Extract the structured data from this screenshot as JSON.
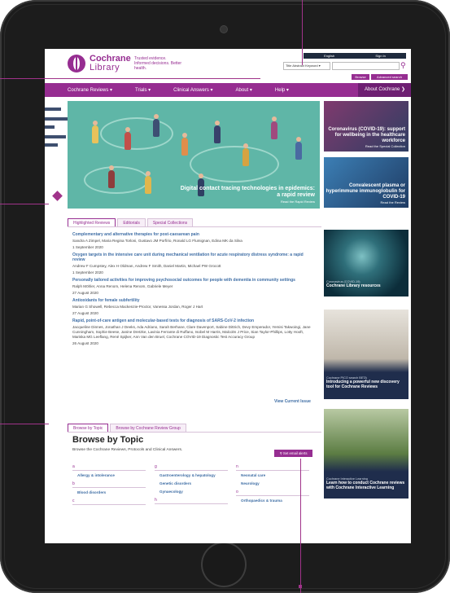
{
  "header": {
    "logo_line1": "Cochrane",
    "logo_line2": "Library",
    "tagline": "Trusted evidence. Informed decisions. Better health.",
    "top_links": [
      "English",
      "Sign In"
    ],
    "search_type": "Title Abstract Keyword ▾",
    "search_placeholder": "",
    "browse": "Browse",
    "advanced_search": "Advanced search"
  },
  "nav": {
    "items": [
      "Cochrane Reviews ▾",
      "Trials ▾",
      "Clinical Answers ▾",
      "About ▾",
      "Help ▾"
    ],
    "about_cochrane": "About Cochrane ❯"
  },
  "hero": {
    "title": "Digital contact tracing technologies in epidemics: a rapid review",
    "link": "Read the Rapid Review"
  },
  "side_cards": [
    {
      "title": "Coronavirus (COVID-19): support for wellbeing in the healthcare workforce",
      "link": "Read the Special Collection"
    },
    {
      "title": "Convalescent plasma or hyperimmune immunoglobulin for COVID-19",
      "link": "Read the Review"
    }
  ],
  "highlight_tabs": [
    "Highlighted Reviews",
    "Editorials",
    "Special Collections"
  ],
  "reviews": [
    {
      "title": "Complementary and alternative therapies for post-caesarean pain",
      "authors": "Sandra A Zimpel, Maria Regina Torloni, Gustavo JM Porfírio, Ronald LG Flumignan, Edina MK da Silva",
      "date": "1 September 2020"
    },
    {
      "title": "Oxygen targets in the intensive care unit during mechanical ventilation for acute respiratory distress syndrome: a rapid review",
      "authors": "Andrew F Cumpstey, Alex H Oldman, Andrew F Smith, Daniel Martin, Michael PW Grocott",
      "date": "1 September 2020"
    },
    {
      "title": "Personally tailored activities for improving psychosocial outcomes for people with dementia in community settings",
      "authors": "Ralph Möhler, Anna Renom, Helena Renom, Gabriele Meyer",
      "date": "27 August 2020"
    },
    {
      "title": "Antioxidants for female subfertility",
      "authors": "Marian G Showell, Rebecca Mackenzie-Proctor, Vanessa Jordan, Roger J Hart",
      "date": "27 August 2020"
    },
    {
      "title": "Rapid, point-of-care antigen and molecular-based tests for diagnosis of SARS-CoV-2 infection",
      "authors": "Jacqueline Dinnes, Jonathan J Deeks, Ada Adriano, Sarah Berhane, Clare Davenport, Sabine Dittrich, Devy Emperador, Yemisi Takwoingi, Jane Cunningham, Sophie Beese, Janine Dretzke, Lavinia Ferrante di Ruffano, Isobel M Harris, Malcolm J Price, Sian Taylor-Phillips, Lotty Hooft, Mariska MG Leeflang, René Spijker, Ann Van den Bruel, Cochrane COVID-19 Diagnostic Test Accuracy Group",
      "date": "26 August 2020"
    }
  ],
  "view_current_issue": "View Current Issue",
  "right_cards": [
    {
      "kicker": "Coronavirus (COVID-19)",
      "title": "Cochrane Library resources"
    },
    {
      "kicker": "Cochrane PICO search BETA",
      "title": "Introducing a powerful new discovery tool for Cochrane Reviews"
    },
    {
      "kicker": "Cochrane Interactive Learning",
      "title": "Learn how to conduct Cochrane reviews with Cochrane Interactive Learning"
    }
  ],
  "browse_tabs": [
    "Browse by Topic",
    "Browse by Cochrane Review Group"
  ],
  "browse": {
    "title": "Browse by Topic",
    "subtitle": "Browse the Cochrane Reviews, Protocols and Clinical Answers.",
    "alerts_button": "Set email alerts",
    "columns": [
      {
        "letter1": "a",
        "item1": "Allergy & intolerance",
        "letter2": "b",
        "item2": "Blood disorders",
        "letter3": "c"
      },
      {
        "letter1": "g",
        "item1": "Gastroenterology & hepatology",
        "item2": "Genetic disorders",
        "item3": "Gynaecology",
        "letter3": "h"
      },
      {
        "letter1": "n",
        "item1": "Neonatal care",
        "item2": "Neurology",
        "letter2": "o",
        "item3": "Orthopaedics & trauma"
      }
    ]
  },
  "colors": {
    "brand": "#962d91",
    "link": "#3f6ea5",
    "nav_dark": "#6e1f72"
  }
}
